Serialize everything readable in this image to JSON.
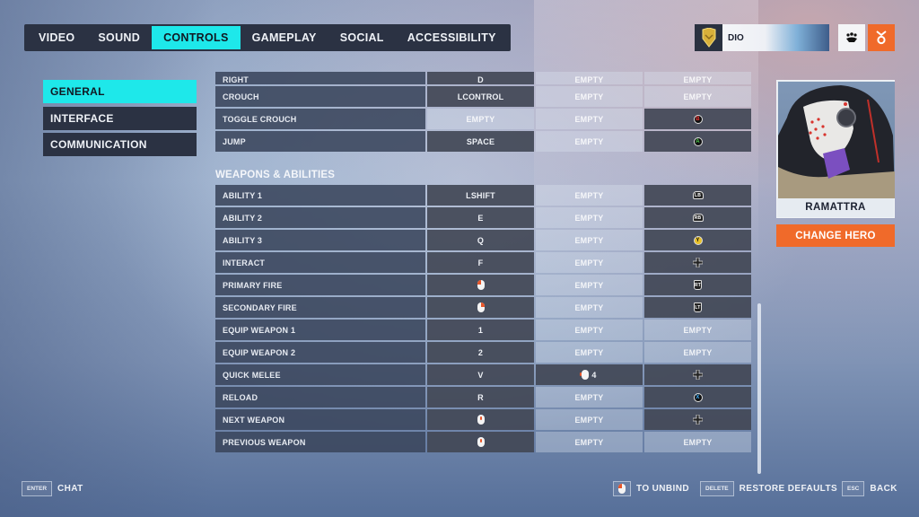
{
  "top_tabs": [
    {
      "label": "VIDEO",
      "active": false
    },
    {
      "label": "SOUND",
      "active": false
    },
    {
      "label": "CONTROLS",
      "active": true
    },
    {
      "label": "GAMEPLAY",
      "active": false
    },
    {
      "label": "SOCIAL",
      "active": false
    },
    {
      "label": "ACCESSIBILITY",
      "active": false
    }
  ],
  "profile": {
    "player_name": "DIO",
    "rank_icon": "gold-rank-badge-icon",
    "friends_icon": "friends-icon",
    "rewards_icon": "rewards-icon"
  },
  "side_nav": [
    {
      "label": "GENERAL",
      "active": true
    },
    {
      "label": "INTERFACE",
      "active": false
    },
    {
      "label": "COMMUNICATION",
      "active": false
    }
  ],
  "bindings": {
    "movement_rows": [
      {
        "action": "RIGHT",
        "primary": "D",
        "secondary": "EMPTY",
        "controller": "EMPTY"
      },
      {
        "action": "CROUCH",
        "primary": "LCONTROL",
        "secondary": "EMPTY",
        "controller": "EMPTY"
      },
      {
        "action": "TOGGLE CROUCH",
        "primary": "EMPTY",
        "secondary": "EMPTY",
        "controller": "B-button-icon"
      },
      {
        "action": "JUMP",
        "primary": "SPACE",
        "secondary": "EMPTY",
        "controller": "A-button-icon"
      }
    ],
    "weapons_section_title": "WEAPONS & ABILITIES",
    "weapons_rows": [
      {
        "action": "ABILITY 1",
        "primary": "LSHIFT",
        "secondary": "EMPTY",
        "controller": "LB-bumper-icon"
      },
      {
        "action": "ABILITY 2",
        "primary": "E",
        "secondary": "EMPTY",
        "controller": "RB-bumper-icon"
      },
      {
        "action": "ABILITY 3",
        "primary": "Q",
        "secondary": "EMPTY",
        "controller": "Y-button-icon"
      },
      {
        "action": "INTERACT",
        "primary": "F",
        "secondary": "EMPTY",
        "controller": "dpad-up-icon"
      },
      {
        "action": "PRIMARY FIRE",
        "primary": "mouse-left-icon",
        "secondary": "EMPTY",
        "controller": "RT-trigger-icon"
      },
      {
        "action": "SECONDARY FIRE",
        "primary": "mouse-right-icon",
        "secondary": "EMPTY",
        "controller": "LT-trigger-icon"
      },
      {
        "action": "EQUIP WEAPON  1",
        "primary": "1",
        "secondary": "EMPTY",
        "controller": "EMPTY"
      },
      {
        "action": "EQUIP WEAPON 2",
        "primary": "2",
        "secondary": "EMPTY",
        "controller": "EMPTY"
      },
      {
        "action": "QUICK MELEE",
        "primary": "V",
        "secondary": "mouse-button-4-icon",
        "secondary_text": "4",
        "controller": "dpad-down-icon"
      },
      {
        "action": "RELOAD",
        "primary": "R",
        "secondary": "EMPTY",
        "controller": "X-button-icon"
      },
      {
        "action": "NEXT WEAPON",
        "primary": "mouse-wheel-up-icon",
        "secondary": "EMPTY",
        "controller": "dpad-right-icon"
      },
      {
        "action": "PREVIOUS WEAPON",
        "primary": "mouse-wheel-down-icon",
        "secondary": "EMPTY",
        "controller": "EMPTY"
      }
    ]
  },
  "hero": {
    "name": "RAMATTRA",
    "change_label": "CHANGE HERO"
  },
  "footer": {
    "chat_key": "ENTER",
    "chat_label": "CHAT",
    "unbind_label": "TO UNBIND",
    "restore_key": "DELETE",
    "restore_label": "RESTORE DEFAULTS",
    "back_key": "ESC",
    "back_label": "BACK"
  },
  "colors": {
    "accent_cyan": "#1ee8ea",
    "accent_orange": "#f06a2a",
    "panel_dark": "#2b3243"
  }
}
